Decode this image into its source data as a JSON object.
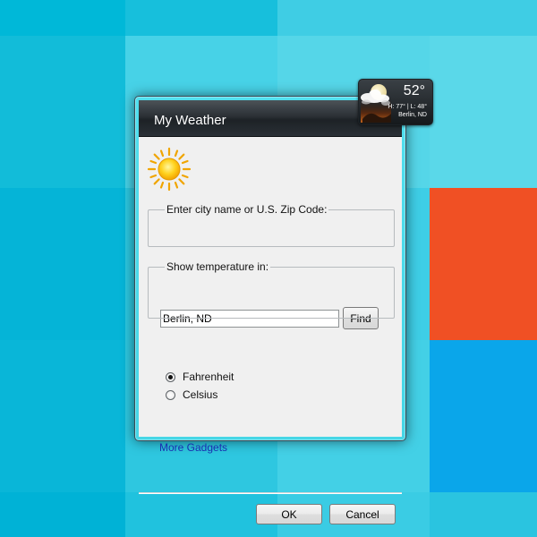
{
  "desktop": {
    "tile_colors": [
      "#00b4d8",
      "#2cc4de",
      "#47d4e8",
      "#5dd8e8",
      "#f05024",
      "#0aa6ea"
    ]
  },
  "dialog": {
    "title": "My Weather",
    "city_group_label": "Enter city name or U.S. Zip Code:",
    "city_value": "Berlin, ND",
    "find_label": "Find",
    "temp_group_label": "Show temperature in:",
    "temp_options": [
      {
        "label": "Fahrenheit",
        "selected": true
      },
      {
        "label": "Celsius",
        "selected": false
      }
    ],
    "more_gadgets_label": "More Gadgets",
    "ok_label": "OK",
    "cancel_label": "Cancel",
    "icon": "sun-icon"
  },
  "gadget": {
    "temperature": "52°",
    "high_low": "H: 77° | L: 48°",
    "city": "Berlin, ND",
    "icon": "partly-cloudy-night-icon"
  },
  "colors": {
    "titlebar": "#2a3036",
    "client_bg": "#f0f0f0",
    "link": "#1a2fb0",
    "accent_orange": "#f05024"
  }
}
